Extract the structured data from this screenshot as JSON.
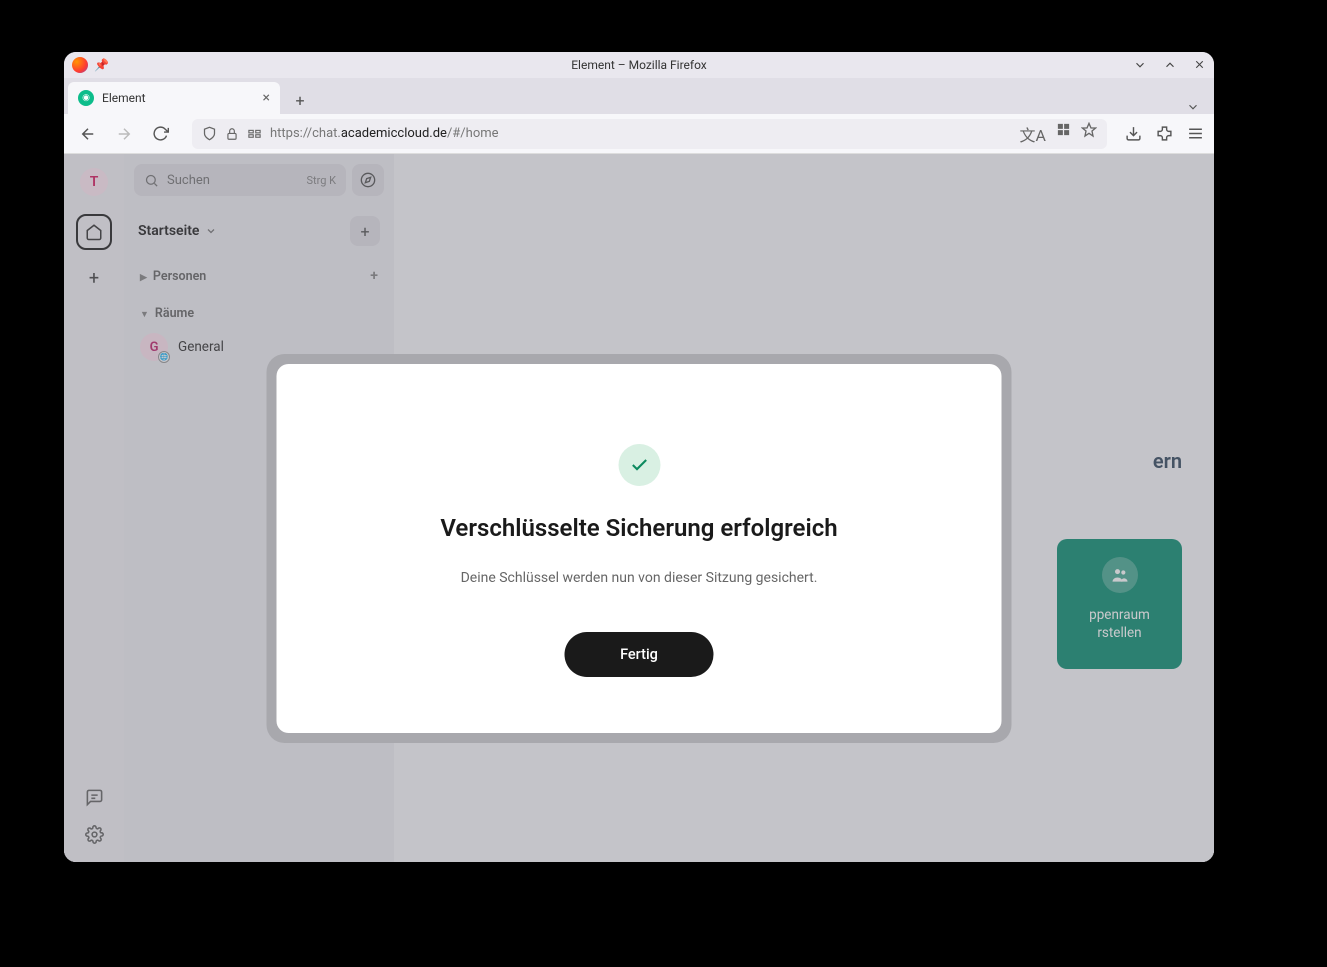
{
  "window_title": "Element – Mozilla Firefox",
  "tab": {
    "label": "Element"
  },
  "url": {
    "prefix": "https://chat.",
    "domain": "academiccloud.de",
    "path": "/#/home"
  },
  "sidebar": {
    "avatar_letter": "T",
    "search_placeholder": "Suchen",
    "search_shortcut": "Strg K",
    "home_label": "Startseite",
    "sections": {
      "people": "Personen",
      "rooms": "Räume"
    },
    "room_items": [
      {
        "avatar_letter": "G",
        "label": "General"
      }
    ]
  },
  "background": {
    "headline_fragment": "ern",
    "card_line1": "ppenraum",
    "card_line2": "rstellen"
  },
  "modal": {
    "title": "Verschlüsselte Sicherung erfolgreich",
    "body": "Deine Schlüssel werden nun von dieser Sitzung gesichert.",
    "button": "Fertig"
  }
}
